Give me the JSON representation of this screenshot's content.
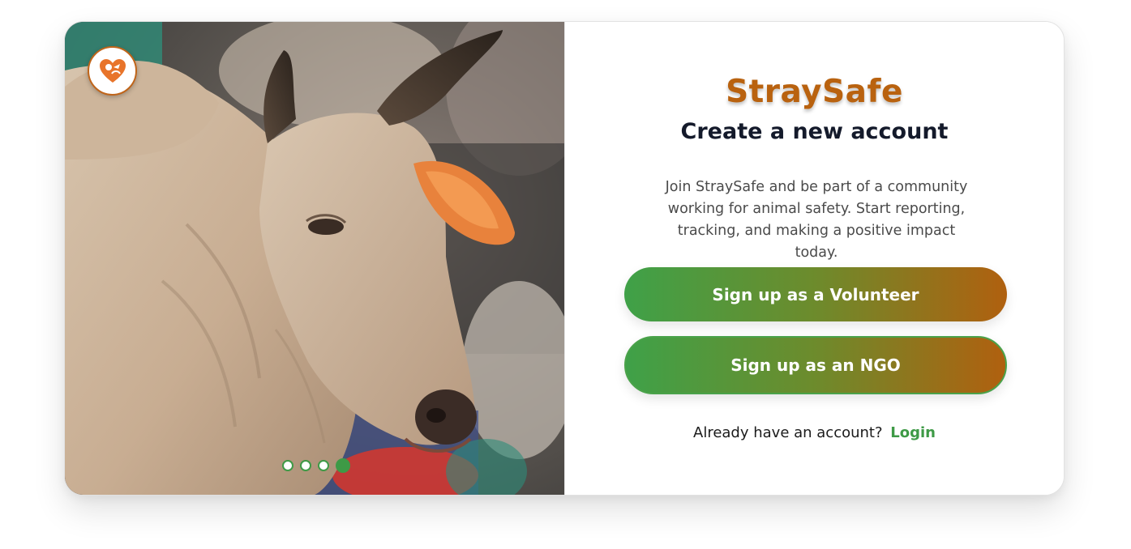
{
  "brand": {
    "name": "StraySafe",
    "color": "#b9620f"
  },
  "page": {
    "subtitle": "Create a new account",
    "description": "Join StraySafe and be part of a community working for animal safety. Start reporting, tracking, and making a positive impact today."
  },
  "actions": {
    "volunteer_label": "Sign up as a Volunteer",
    "ngo_label": "Sign up as an NGO"
  },
  "login": {
    "prompt": "Already have an account?",
    "link_label": "Login"
  },
  "carousel": {
    "slide_count": 4,
    "active_index": 3,
    "image_subject": "cow-photo"
  },
  "colors": {
    "accent_green": "#3e9a46",
    "accent_orange": "#b0600f",
    "heading_dark": "#141a2b"
  },
  "icons": {
    "logo": "heart-paw-logo-icon"
  }
}
